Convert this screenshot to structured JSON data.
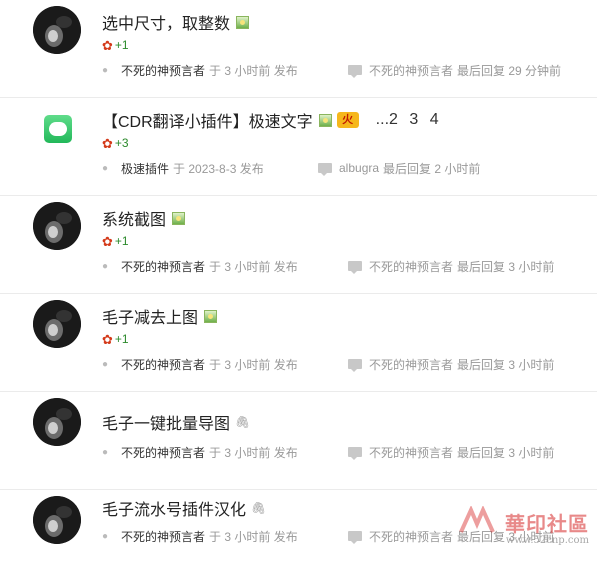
{
  "threads": [
    {
      "title": "选中尺寸，取整数",
      "icons": [
        "image-icon"
      ],
      "rate": "+1",
      "author": "不死的神预言者",
      "post_time": "于 3 小时前 发布",
      "last_reply_user": "不死的神预言者",
      "last_reply_time": "最后回复 29 分钟前"
    },
    {
      "title": "【CDR翻译小插件】极速文字",
      "icons": [
        "image-icon",
        "hot-icon"
      ],
      "hot_label": "火",
      "pages": [
        "...2",
        "3",
        "4"
      ],
      "rate": "+3",
      "author": "极速插件",
      "post_time": "于 2023-8-3 发布",
      "last_reply_user": "albugra",
      "last_reply_time": "最后回复 2 小时前"
    },
    {
      "title": "系统截图",
      "icons": [
        "image-icon"
      ],
      "rate": "+1",
      "author": "不死的神预言者",
      "post_time": "于 3 小时前 发布",
      "last_reply_user": "不死的神预言者",
      "last_reply_time": "最后回复 3 小时前"
    },
    {
      "title": "毛子减去上图",
      "icons": [
        "image-icon"
      ],
      "rate": "+1",
      "author": "不死的神预言者",
      "post_time": "于 3 小时前 发布",
      "last_reply_user": "不死的神预言者",
      "last_reply_time": "最后回复 3 小时前"
    },
    {
      "title": "毛子一键批量导图",
      "icons": [
        "attachment-icon"
      ],
      "rate": "",
      "author": "不死的神预言者",
      "post_time": "于 3 小时前 发布",
      "last_reply_user": "不死的神预言者",
      "last_reply_time": "最后回复 3 小时前"
    },
    {
      "title": "毛子流水号插件汉化",
      "icons": [
        "attachment-icon"
      ],
      "rate": "",
      "author": "不死的神预言者",
      "post_time": "于 3 小时前 发布",
      "last_reply_user": "不死的神预言者",
      "last_reply_time": "最后回复 3 小时前"
    }
  ],
  "watermark": {
    "text": "華印社區",
    "url": "www.52cnp.com"
  },
  "colors": {
    "rate_green": "#2c8a2c",
    "author_text": "#333333",
    "muted_text": "#999999",
    "divider": "#ebebeb"
  }
}
